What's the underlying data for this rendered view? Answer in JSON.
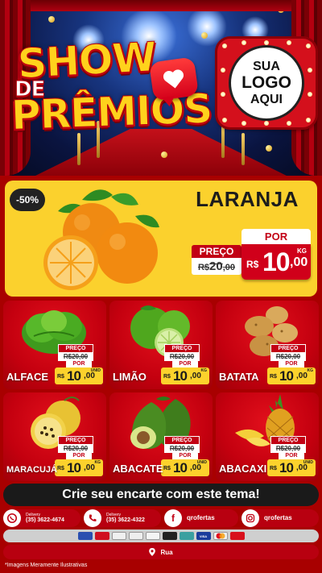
{
  "hero": {
    "title_line1": "SHOW",
    "title_line2": "DE",
    "title_line3": "PRÊMIOS",
    "logo_line1": "SUA",
    "logo_line2": "LOGO",
    "logo_line3": "AQUI",
    "icons": [
      "heart-icon"
    ]
  },
  "featured": {
    "discount": "-50%",
    "name": "LARANJA",
    "old_label": "PREÇO",
    "old_currency": "R$",
    "old_price": "20",
    "old_cents": ",00",
    "new_label": "POR",
    "new_currency": "R$",
    "new_price": "10",
    "new_cents": ",00",
    "unit": "KG"
  },
  "products": [
    {
      "name": "ALFACE",
      "old_label": "PREÇO",
      "old_price": "R$20,00",
      "new_label": "POR",
      "currency": "R$",
      "price": "10",
      "cents": ",00",
      "unit": "UNID"
    },
    {
      "name": "LIMÃO",
      "old_label": "PREÇO",
      "old_price": "R$20,00",
      "new_label": "POR",
      "currency": "R$",
      "price": "10",
      "cents": ",00",
      "unit": "KG"
    },
    {
      "name": "BATATA",
      "old_label": "PREÇO",
      "old_price": "R$20,00",
      "new_label": "POR",
      "currency": "R$",
      "price": "10",
      "cents": ",00",
      "unit": "KG"
    },
    {
      "name": "MARACUJÁ",
      "old_label": "PREÇO",
      "old_price": "R$20,00",
      "new_label": "POR",
      "currency": "R$",
      "price": "10",
      "cents": ",00",
      "unit": "KG"
    },
    {
      "name": "ABACATE",
      "old_label": "PREÇO",
      "old_price": "R$20,00",
      "new_label": "POR",
      "currency": "R$",
      "price": "10",
      "cents": ",00",
      "unit": "UNID"
    },
    {
      "name": "ABACAXI",
      "old_label": "PREÇO",
      "old_price": "R$20,00",
      "new_label": "POR",
      "currency": "R$",
      "price": "10",
      "cents": ",00",
      "unit": "UNID"
    }
  ],
  "footer": {
    "cta": "Crie seu encarte com este tema!",
    "whatsapp_label": "Delivery",
    "whatsapp_number": "(35) 3622-4674",
    "phone_label": "Delivery",
    "phone_number": "(35) 3622-4322",
    "facebook": "qrofertas",
    "instagram": "qrofertas",
    "address": "Rua",
    "disclaimer": "*Imagens Meramente Ilustrativas",
    "visa_label": "VISA",
    "accent_color": "#c20014",
    "highlight_color": "#fcd22c"
  }
}
